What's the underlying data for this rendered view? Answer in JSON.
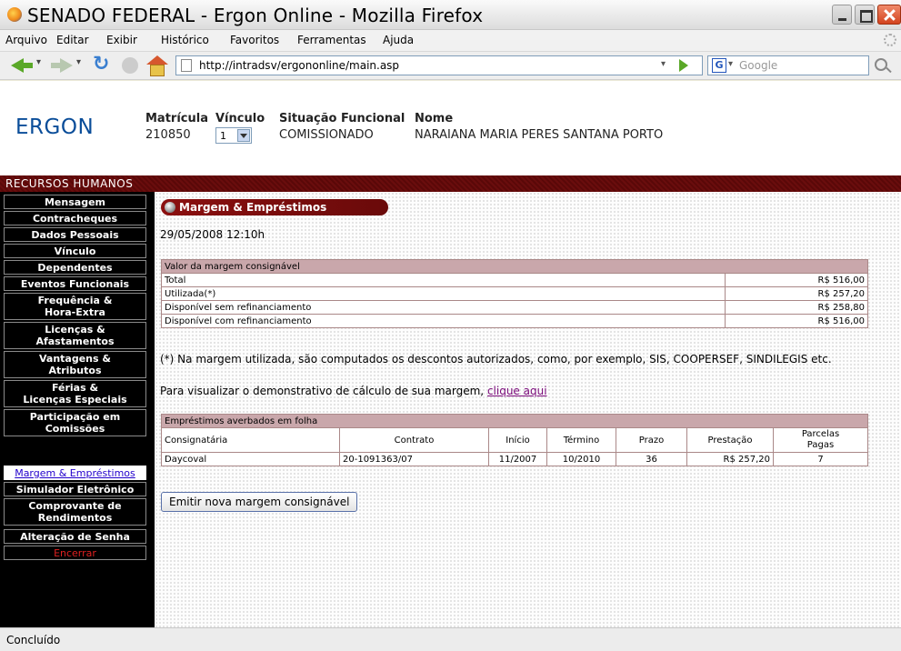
{
  "window": {
    "title": "SENADO FEDERAL - Ergon Online - Mozilla Firefox"
  },
  "menu": [
    "Arquivo",
    "Editar",
    "Exibir",
    "Histórico",
    "Favoritos",
    "Ferramentas",
    "Ajuda"
  ],
  "nav": {
    "url": "http://intradsv/ergononline/main.asp",
    "search_placeholder": "Google"
  },
  "header": {
    "logo": "ERGON",
    "matricula_label": "Matrícula",
    "matricula_value": "210850",
    "vinculo_label": "Vínculo",
    "vinculo_value": "1",
    "situacao_label": "Situação Funcional",
    "situacao_value": "COMISSIONADO",
    "nome_label": "Nome",
    "nome_value": "NARAIANA MARIA PERES SANTANA PORTO"
  },
  "band": {
    "label": "RECURSOS HUMANOS"
  },
  "sidebar": [
    "Mensagem",
    "Contracheques",
    "Dados Pessoais",
    "Vínculo",
    "Dependentes",
    "Eventos Funcionais",
    "Frequência &\nHora-Extra",
    "Licenças &\nAfastamentos",
    "Vantagens &\nAtributos",
    "Férias &\nLicenças Especiais",
    "Participação em\nComissões",
    "Margem & Empréstimos",
    "Simulador Eletrônico",
    "Comprovante de\nRendimentos",
    "Alteração de Senha",
    "Encerrar"
  ],
  "main": {
    "section_title": "Margem & Empréstimos",
    "date": "29/05/2008 12:10h",
    "margin_table": {
      "caption": "Valor da margem consignável",
      "rows": [
        [
          "Total",
          "R$ 516,00"
        ],
        [
          "Utilizada(*)",
          "R$ 257,20"
        ],
        [
          "Disponível sem refinanciamento",
          "R$ 258,80"
        ],
        [
          "Disponível com refinanciamento",
          "R$ 516,00"
        ]
      ]
    },
    "note": "(*) Na margem utilizada, são computados os descontos autorizados, como, por exemplo, SIS, COOPERSEF, SINDILEGIS etc.",
    "calc_text": "Para visualizar o demonstrativo de cálculo de sua margem,",
    "calc_link": "clique aqui",
    "loans_table": {
      "caption": "Empréstimos averbados em folha",
      "headers": [
        "Consignatária",
        "Contrato",
        "Início",
        "Término",
        "Prazo",
        "Prestação",
        "Parcelas\nPagas"
      ],
      "rows": [
        [
          "Daycoval",
          "20-1091363/07",
          "11/2007",
          "10/2010",
          "36",
          "R$ 257,20",
          "7"
        ]
      ]
    },
    "emit_button": "Emitir nova margem consignável"
  },
  "status": {
    "text": "Concluído"
  }
}
